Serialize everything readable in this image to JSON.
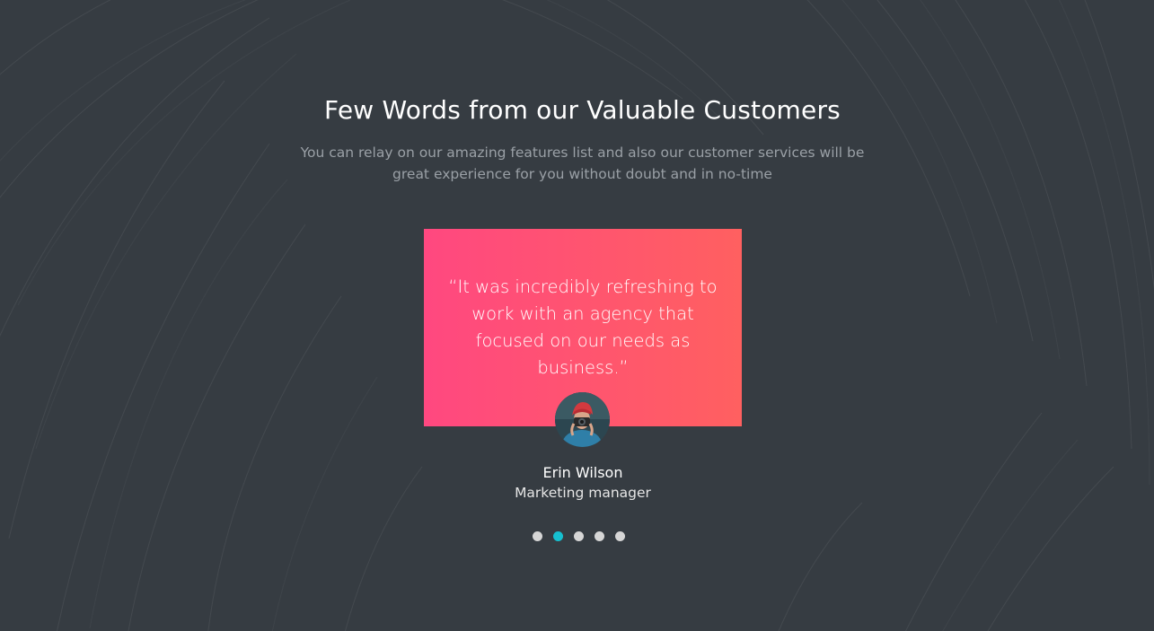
{
  "testimonials": {
    "title": "Few Words from our Valuable Customers",
    "subtitle": "You can relay on our amazing features list and also our customer services will be great experience for you without doubt and in no-time",
    "quote": "“It was incredibly refreshing to work with an agency that focused on our needs as business.”",
    "author_name": "Erin Wilson",
    "author_role": "Marketing manager",
    "active_slide": 2,
    "slide_count": 5
  },
  "colors": {
    "background": "#363c42",
    "card_gradient_start": "#ff4880",
    "card_gradient_end": "#ff6060",
    "active_dot": "#16c0d0",
    "inactive_dot": "#d6d6d6"
  },
  "icons": {
    "avatar": "person-with-camera-avatar"
  }
}
